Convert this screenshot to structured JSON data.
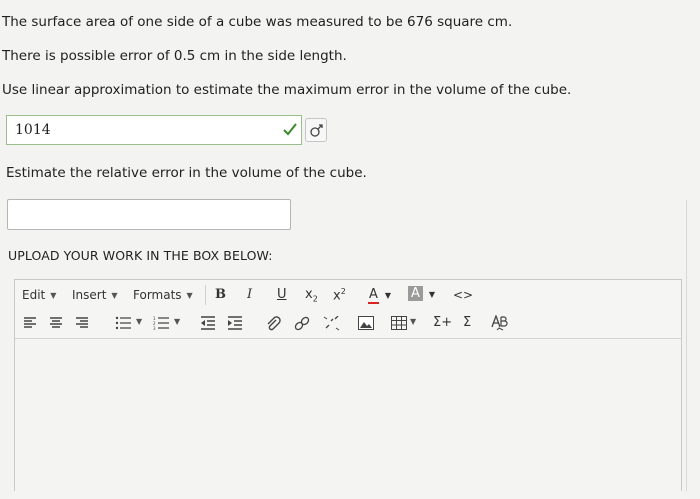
{
  "question": {
    "line1": "The surface area of one side of a cube was measured to be 676 square cm.",
    "line2": "There is possible error of 0.5 cm in the side length.",
    "line3": "Use linear approximation to estimate the maximum error in the volume of the cube.",
    "answer1_value": "1014",
    "line4": "Estimate the relative error in the volume of the cube.",
    "answer2_value": ""
  },
  "upload_label": "UPLOAD YOUR WORK IN THE BOX BELOW:",
  "editor": {
    "menus": {
      "edit": "Edit",
      "insert": "Insert",
      "formats": "Formats"
    },
    "bold": "B",
    "italic": "I",
    "underline": "U",
    "subscript": "x",
    "superscript": "x",
    "code": "<>",
    "sigma_plus": "Σ+",
    "sigma": "Σ"
  },
  "colors": {
    "correct_check": "#3a8a2a",
    "text_color_underline": "#d22",
    "bg_color_swatch": "#9a9a9a"
  },
  "icons": [
    "check-icon",
    "equation-keyboard-icon",
    "align-left-icon",
    "align-center-icon",
    "align-right-icon",
    "bullet-list-icon",
    "numbered-list-icon",
    "outdent-icon",
    "indent-icon",
    "attachment-icon",
    "link-icon",
    "unlink-icon",
    "image-icon",
    "table-icon",
    "sigma-plus-icon",
    "sigma-icon",
    "spellcheck-icon"
  ]
}
